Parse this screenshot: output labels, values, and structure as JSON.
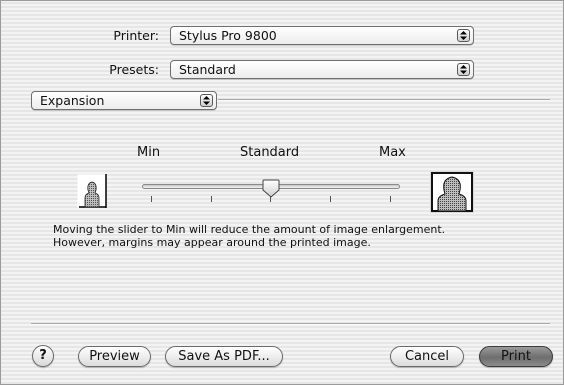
{
  "printer": {
    "label": "Printer:",
    "value": "Stylus Pro 9800"
  },
  "presets": {
    "label": "Presets:",
    "value": "Standard"
  },
  "panel": {
    "value": "Expansion"
  },
  "expansion": {
    "slider_labels": {
      "min": "Min",
      "standard": "Standard",
      "max": "Max"
    },
    "slider_value": "Standard",
    "slider_positions": 5,
    "description_line1": "Moving the slider to Min will reduce the amount of image enlargement.",
    "description_line2": "However, margins may appear around the printed image."
  },
  "buttons": {
    "help": "?",
    "preview": "Preview",
    "save_as_pdf": "Save As PDF...",
    "cancel": "Cancel",
    "print": "Print"
  },
  "icons": {
    "popup_arrows": "up-down-arrows-icon",
    "min_image": "portrait-small-icon",
    "max_image": "portrait-large-icon"
  }
}
